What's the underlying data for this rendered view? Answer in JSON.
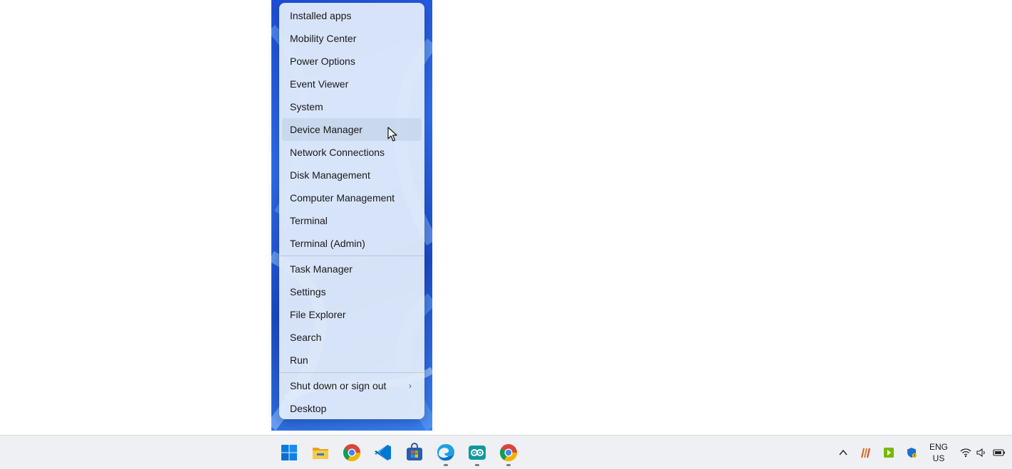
{
  "menu": {
    "items": [
      {
        "label": "Installed apps"
      },
      {
        "label": "Mobility Center"
      },
      {
        "label": "Power Options"
      },
      {
        "label": "Event Viewer"
      },
      {
        "label": "System"
      },
      {
        "label": "Device Manager"
      },
      {
        "label": "Network Connections"
      },
      {
        "label": "Disk Management"
      },
      {
        "label": "Computer Management"
      },
      {
        "label": "Terminal"
      },
      {
        "label": "Terminal (Admin)"
      },
      {
        "label": "Task Manager"
      },
      {
        "label": "Settings"
      },
      {
        "label": "File Explorer"
      },
      {
        "label": "Search"
      },
      {
        "label": "Run"
      },
      {
        "label": "Shut down or sign out"
      },
      {
        "label": "Desktop"
      }
    ],
    "hovered_item": "Device Manager",
    "submenu_chevron": "›"
  },
  "taskbar": {
    "pinned_icons": [
      "start-icon",
      "file-explorer-icon",
      "chrome-icon",
      "vscode-icon",
      "microsoft-store-icon",
      "edge-icon",
      "arduino-icon",
      "chrome-icon"
    ],
    "tray": {
      "chevron": "^",
      "language_line1": "ENG",
      "language_line2": "US",
      "icons": [
        "show-hidden-icons-chevron",
        "app-tray-icon",
        "nvidia-icon",
        "windows-security-icon",
        "wifi-icon",
        "volume-icon",
        "battery-icon"
      ]
    }
  },
  "colors": {
    "menu_background": "#e2ecfa",
    "hover_highlight": "#bccde1",
    "taskbar_background": "#eef0f3",
    "wallpaper_blue": "#1d4fd8"
  }
}
